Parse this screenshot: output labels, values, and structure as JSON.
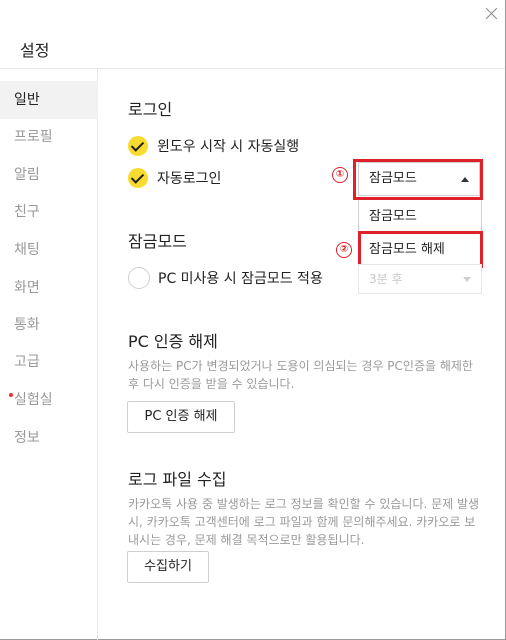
{
  "window": {
    "title": "설정"
  },
  "sidebar": {
    "items": [
      {
        "label": "일반"
      },
      {
        "label": "프로필"
      },
      {
        "label": "알림"
      },
      {
        "label": "친구"
      },
      {
        "label": "채팅"
      },
      {
        "label": "화면"
      },
      {
        "label": "통화"
      },
      {
        "label": "고급"
      },
      {
        "label": "실험실"
      },
      {
        "label": "정보"
      }
    ],
    "active": "일반"
  },
  "login": {
    "title": "로그인",
    "auto_run_label": "윈도우 시작 시 자동실행",
    "auto_run_checked": true,
    "auto_login_label": "자동로그인",
    "auto_login_checked": true,
    "mode_select_value": "잠금모드",
    "mode_options": [
      "잠금모드",
      "잠금모드 해제"
    ]
  },
  "annotations": {
    "badge_1": "①",
    "badge_2": "②",
    "color": "#e0202a"
  },
  "lock_mode": {
    "title": "잠금모드",
    "option_label": "PC 미사용 시 잠금모드 적용",
    "option_checked": false,
    "delay_value": "3분 후"
  },
  "pc_auth": {
    "title": "PC 인증 해제",
    "description": "사용하는 PC가 변경되었거나 도용이 의심되는 경우 PC인증을 해제한 후 다시 인증을 받을 수 있습니다.",
    "button_label": "PC 인증 해제"
  },
  "log_collect": {
    "title": "로그 파일 수집",
    "description": "카카오톡 사용 중 발생하는 로그 정보를 확인할 수 있습니다. 문제 발생시, 카카오톡 고객센터에 로그 파일과 함께 문의해주세요. 카카오로 보내시는 경우, 문제 해결 목적으로만 활용됩니다.",
    "button_label": "수집하기"
  },
  "colors": {
    "accent": "#f7dc2f",
    "highlight": "#e0202a",
    "muted_text": "#9a9a9a"
  }
}
